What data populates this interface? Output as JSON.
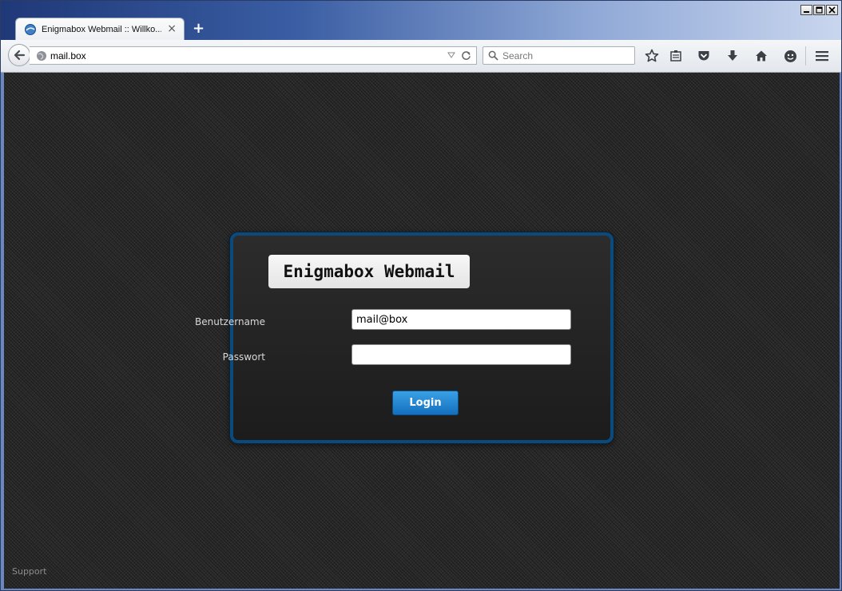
{
  "browser": {
    "tab_title": "Enigmabox Webmail :: Willko...",
    "tab_close": "×",
    "new_tab": "+",
    "url": "mail.box",
    "search_placeholder": "Search",
    "toolbar_icons": [
      "star-icon",
      "reading-list-icon",
      "pocket-icon",
      "download-icon",
      "home-icon",
      "hello-icon",
      "menu-icon"
    ]
  },
  "login": {
    "logo_text": "Enigmabox Webmail",
    "username_label": "Benutzername",
    "username_value": "mail@box",
    "password_label": "Passwort",
    "password_value": "",
    "login_button": "Login"
  },
  "footer": {
    "support_link": "Support"
  },
  "colors": {
    "panel_border": "#0d4a7c",
    "button_top": "#3aa0e6",
    "button_bottom": "#146fbd",
    "background": "#2a2a2a"
  }
}
